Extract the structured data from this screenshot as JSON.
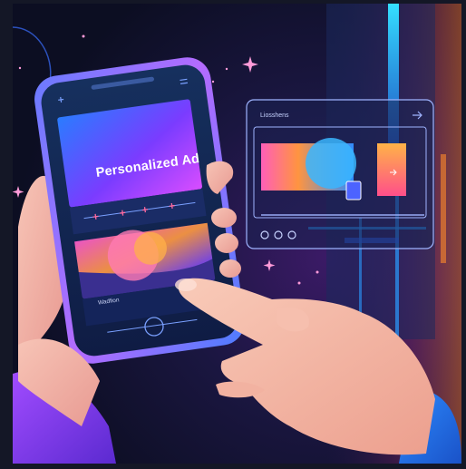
{
  "phone": {
    "ad_title": "Personalized Ad",
    "card_caption": "Wadfion"
  },
  "panel": {
    "title": "Liosshens"
  },
  "colors": {
    "background_dark": "#0d0f22",
    "accent_cyan": "#2fd4ff",
    "accent_magenta": "#e24cff",
    "accent_orange": "#ff8a2a",
    "skin": "#f3b4a8"
  },
  "icons": [
    "sparkle-icon",
    "arrow-right-icon",
    "menu-icon",
    "plus-icon",
    "home-button-icon"
  ]
}
